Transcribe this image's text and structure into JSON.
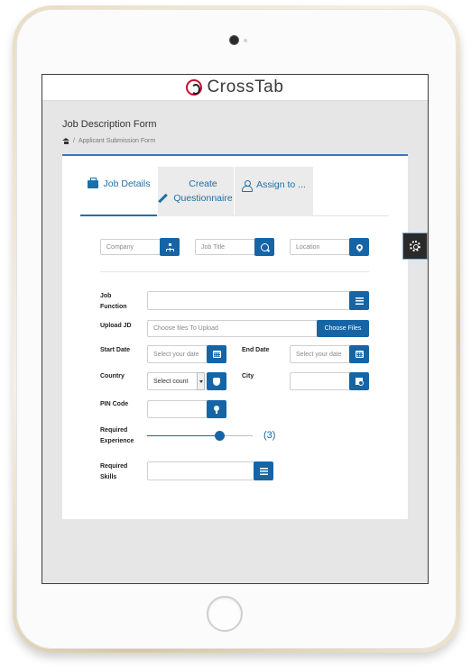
{
  "brand": {
    "name": "CrossTab"
  },
  "page": {
    "title": "Job Description Form"
  },
  "breadcrumb": {
    "current": "Applicant Submission Form",
    "separator": "/"
  },
  "tabs": [
    {
      "label": "Job Details",
      "icon": "briefcase-icon",
      "active": true
    },
    {
      "label": "Create Questionnaire",
      "icon": "pencil-icon",
      "active": false
    },
    {
      "label": "Assign to ...",
      "icon": "user-icon",
      "active": false
    }
  ],
  "top_fields": {
    "company": {
      "placeholder": "Company",
      "icon": "sitemap-icon"
    },
    "job_title": {
      "placeholder": "Job Title",
      "icon": "search-icon"
    },
    "location": {
      "placeholder": "Location",
      "icon": "map-marker-icon"
    }
  },
  "form": {
    "job_function": {
      "label": "Job Function",
      "value": "",
      "icon": "list-icon"
    },
    "upload_jd": {
      "label": "Upload JD",
      "placeholder": "Choose files To Upload",
      "button": "Choose Files"
    },
    "start_date": {
      "label": "Start Date",
      "placeholder": "Select your date",
      "icon": "calendar-icon"
    },
    "end_date": {
      "label": "End Date",
      "placeholder": "Select your date",
      "icon": "calendar-icon"
    },
    "country": {
      "label": "Country",
      "value": "Select count",
      "icon": "shield-icon"
    },
    "city": {
      "label": "City",
      "value": "",
      "icon": "city-icon"
    },
    "pin_code": {
      "label": "PIN Code",
      "value": "",
      "icon": "pin-icon"
    },
    "required_experience": {
      "label": "Required Experience",
      "value_text": "(3)",
      "fraction": 0.69
    },
    "required_skills": {
      "label": "Required Skills",
      "value": "",
      "icon": "list-icon"
    }
  },
  "colors": {
    "accent": "#1565a6",
    "tab_text": "#1d6fa8",
    "screen_bg": "#e6e6e6"
  }
}
